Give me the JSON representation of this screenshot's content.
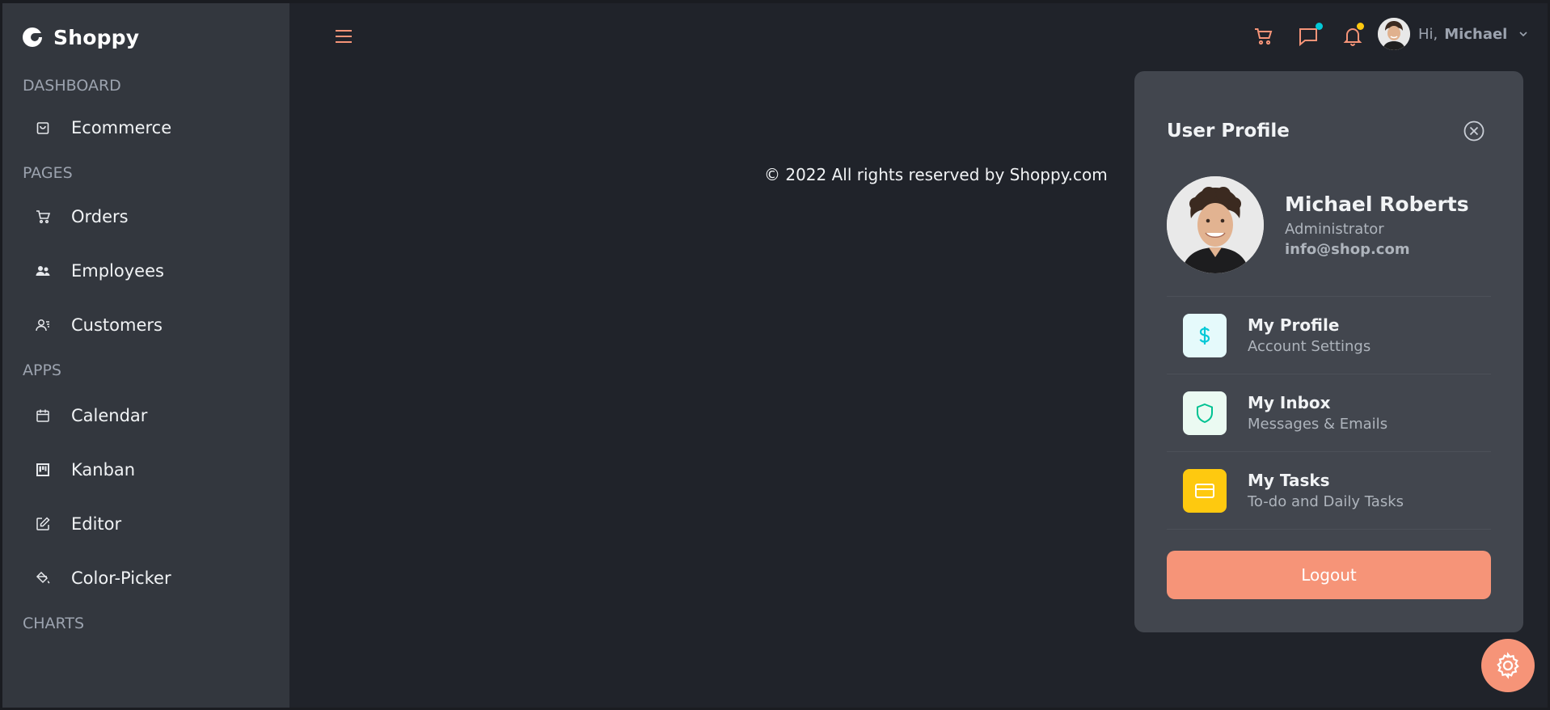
{
  "brand": {
    "name": "Shoppy",
    "icon": "shoppy-logo-icon"
  },
  "sidebar": {
    "sections": [
      {
        "title": "DASHBOARD",
        "items": [
          {
            "label": "Ecommerce",
            "icon": "shopping-bag-icon"
          }
        ]
      },
      {
        "title": "PAGES",
        "items": [
          {
            "label": "Orders",
            "icon": "cart-icon"
          },
          {
            "label": "Employees",
            "icon": "employees-icon"
          },
          {
            "label": "Customers",
            "icon": "customers-icon"
          }
        ]
      },
      {
        "title": "APPS",
        "items": [
          {
            "label": "Calendar",
            "icon": "calendar-icon"
          },
          {
            "label": "Kanban",
            "icon": "kanban-icon"
          },
          {
            "label": "Editor",
            "icon": "edit-icon"
          },
          {
            "label": "Color-Picker",
            "icon": "paint-bucket-icon"
          }
        ]
      },
      {
        "title": "CHARTS",
        "items": []
      }
    ]
  },
  "navbar": {
    "menu_icon": "hamburger-icon",
    "greeting": "Hi,",
    "user_name": "Michael",
    "icons": [
      "cart-icon",
      "chat-icon",
      "bell-icon"
    ],
    "chat_dot_color": "#03C9D7",
    "bell_dot_color": "#FEC90F"
  },
  "footer": {
    "text": "© 2022 All rights reserved by Shoppy.com"
  },
  "profile_panel": {
    "title": "User Profile",
    "name": "Michael Roberts",
    "role": "Administrator",
    "email": "info@shop.com",
    "items": [
      {
        "title": "My Profile",
        "desc": "Account Settings",
        "icon": "dollar-icon",
        "icon_color": "#03C9D7",
        "bg": "#E5FAFB"
      },
      {
        "title": "My Inbox",
        "desc": "Messages & Emails",
        "icon": "shield-icon",
        "icon_color": "#00C292",
        "bg": "#EBFAF2"
      },
      {
        "title": "My Tasks",
        "desc": "To-do and Daily Tasks",
        "icon": "card-icon",
        "icon_color": "#FFFFFF",
        "bg": "#FEC90F"
      }
    ],
    "logout_label": "Logout"
  },
  "colors": {
    "accent": "#F69478",
    "sidebar_bg": "#33373E",
    "main_bg": "#20232A",
    "panel_bg": "#42464E"
  }
}
